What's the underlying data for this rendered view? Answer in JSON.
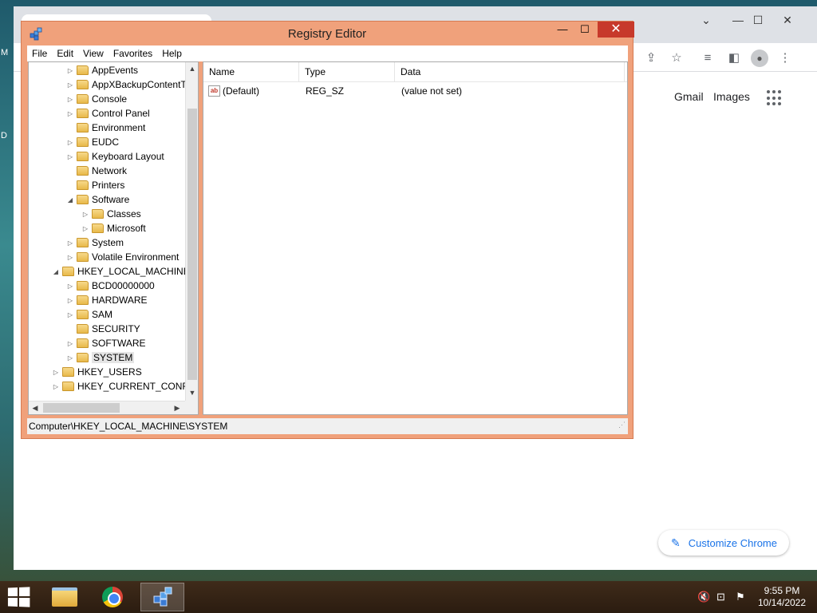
{
  "desktop": {
    "edge_labels": [
      "M",
      "D"
    ]
  },
  "chrome": {
    "toolbar_icons": [
      "share-icon",
      "star-icon",
      "reading-list-icon",
      "side-panel-icon",
      "profile-icon",
      "more-icon"
    ],
    "links": {
      "gmail": "Gmail",
      "images": "Images"
    },
    "customize_label": "Customize Chrome"
  },
  "regedit": {
    "title": "Registry Editor",
    "menu": [
      "File",
      "Edit",
      "View",
      "Favorites",
      "Help"
    ],
    "tree": [
      {
        "label": "AppEvents",
        "level": 2,
        "expander": "collapsed"
      },
      {
        "label": "AppXBackupContentType",
        "level": 2,
        "expander": "collapsed"
      },
      {
        "label": "Console",
        "level": 2,
        "expander": "collapsed"
      },
      {
        "label": "Control Panel",
        "level": 2,
        "expander": "collapsed"
      },
      {
        "label": "Environment",
        "level": 2,
        "expander": "none"
      },
      {
        "label": "EUDC",
        "level": 2,
        "expander": "collapsed"
      },
      {
        "label": "Keyboard Layout",
        "level": 2,
        "expander": "collapsed"
      },
      {
        "label": "Network",
        "level": 2,
        "expander": "none"
      },
      {
        "label": "Printers",
        "level": 2,
        "expander": "none"
      },
      {
        "label": "Software",
        "level": 2,
        "expander": "expanded"
      },
      {
        "label": "Classes",
        "level": 3,
        "expander": "collapsed"
      },
      {
        "label": "Microsoft",
        "level": 3,
        "expander": "collapsed"
      },
      {
        "label": "System",
        "level": 2,
        "expander": "collapsed"
      },
      {
        "label": "Volatile Environment",
        "level": 2,
        "expander": "collapsed"
      },
      {
        "label": "HKEY_LOCAL_MACHINE",
        "level": 1,
        "expander": "expanded"
      },
      {
        "label": "BCD00000000",
        "level": 2,
        "expander": "collapsed"
      },
      {
        "label": "HARDWARE",
        "level": 2,
        "expander": "collapsed"
      },
      {
        "label": "SAM",
        "level": 2,
        "expander": "collapsed"
      },
      {
        "label": "SECURITY",
        "level": 2,
        "expander": "none"
      },
      {
        "label": "SOFTWARE",
        "level": 2,
        "expander": "collapsed"
      },
      {
        "label": "SYSTEM",
        "level": 2,
        "expander": "collapsed",
        "selected": true
      },
      {
        "label": "HKEY_USERS",
        "level": 1,
        "expander": "collapsed"
      },
      {
        "label": "HKEY_CURRENT_CONFIG",
        "level": 1,
        "expander": "collapsed"
      }
    ],
    "columns": {
      "name": "Name",
      "type": "Type",
      "data": "Data"
    },
    "values": [
      {
        "name": "(Default)",
        "type": "REG_SZ",
        "data": "(value not set)"
      }
    ],
    "status_path": "Computer\\HKEY_LOCAL_MACHINE\\SYSTEM"
  },
  "taskbar": {
    "apps": [
      "file-explorer-icon",
      "chrome-icon",
      "registry-editor-icon"
    ],
    "clock": {
      "time": "9:55 PM",
      "date": "10/14/2022"
    }
  }
}
